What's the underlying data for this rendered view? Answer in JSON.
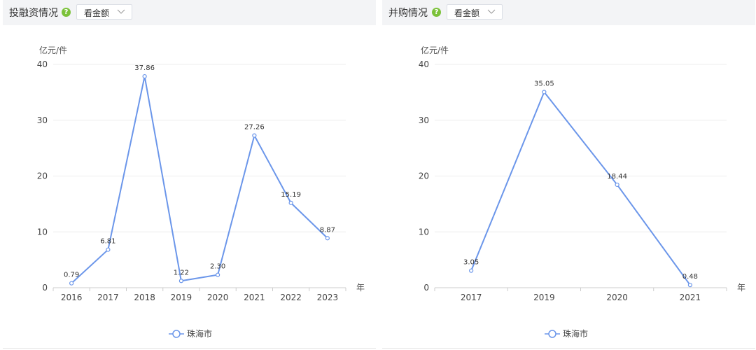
{
  "panels": [
    {
      "title": "投融资情况",
      "dropdown": "看金额",
      "help_icon": "question-icon",
      "chart_data": {
        "type": "line",
        "ylabel": "亿元/件",
        "xlabel": "年",
        "ylim": [
          0,
          40
        ],
        "yticks": [
          "0",
          "10",
          "20",
          "30",
          "40"
        ],
        "categories": [
          "2016",
          "2017",
          "2018",
          "2019",
          "2020",
          "2021",
          "2022",
          "2023"
        ],
        "series": [
          {
            "name": "珠海市",
            "values": [
              0.79,
              6.81,
              37.86,
              1.22,
              2.3,
              27.26,
              15.19,
              8.87
            ],
            "labels": [
              "0.79",
              "6.81",
              "37.86",
              "1.22",
              "2.30",
              "27.26",
              "15.19",
              "8.87"
            ]
          }
        ],
        "grid": true,
        "legend": "bottom-center",
        "color": "#6b96ea"
      }
    },
    {
      "title": "并购情况",
      "dropdown": "看金额",
      "help_icon": "question-icon",
      "chart_data": {
        "type": "line",
        "ylabel": "亿元/件",
        "xlabel": "年",
        "ylim": [
          0,
          40
        ],
        "yticks": [
          "0",
          "10",
          "20",
          "30",
          "40"
        ],
        "categories": [
          "2017",
          "2019",
          "2020",
          "2021"
        ],
        "series": [
          {
            "name": "珠海市",
            "values": [
              3.05,
              35.05,
              18.44,
              0.48
            ],
            "labels": [
              "3.05",
              "35.05",
              "18.44",
              "0.48"
            ]
          }
        ],
        "grid": true,
        "legend": "bottom-center",
        "color": "#6b96ea"
      }
    }
  ]
}
